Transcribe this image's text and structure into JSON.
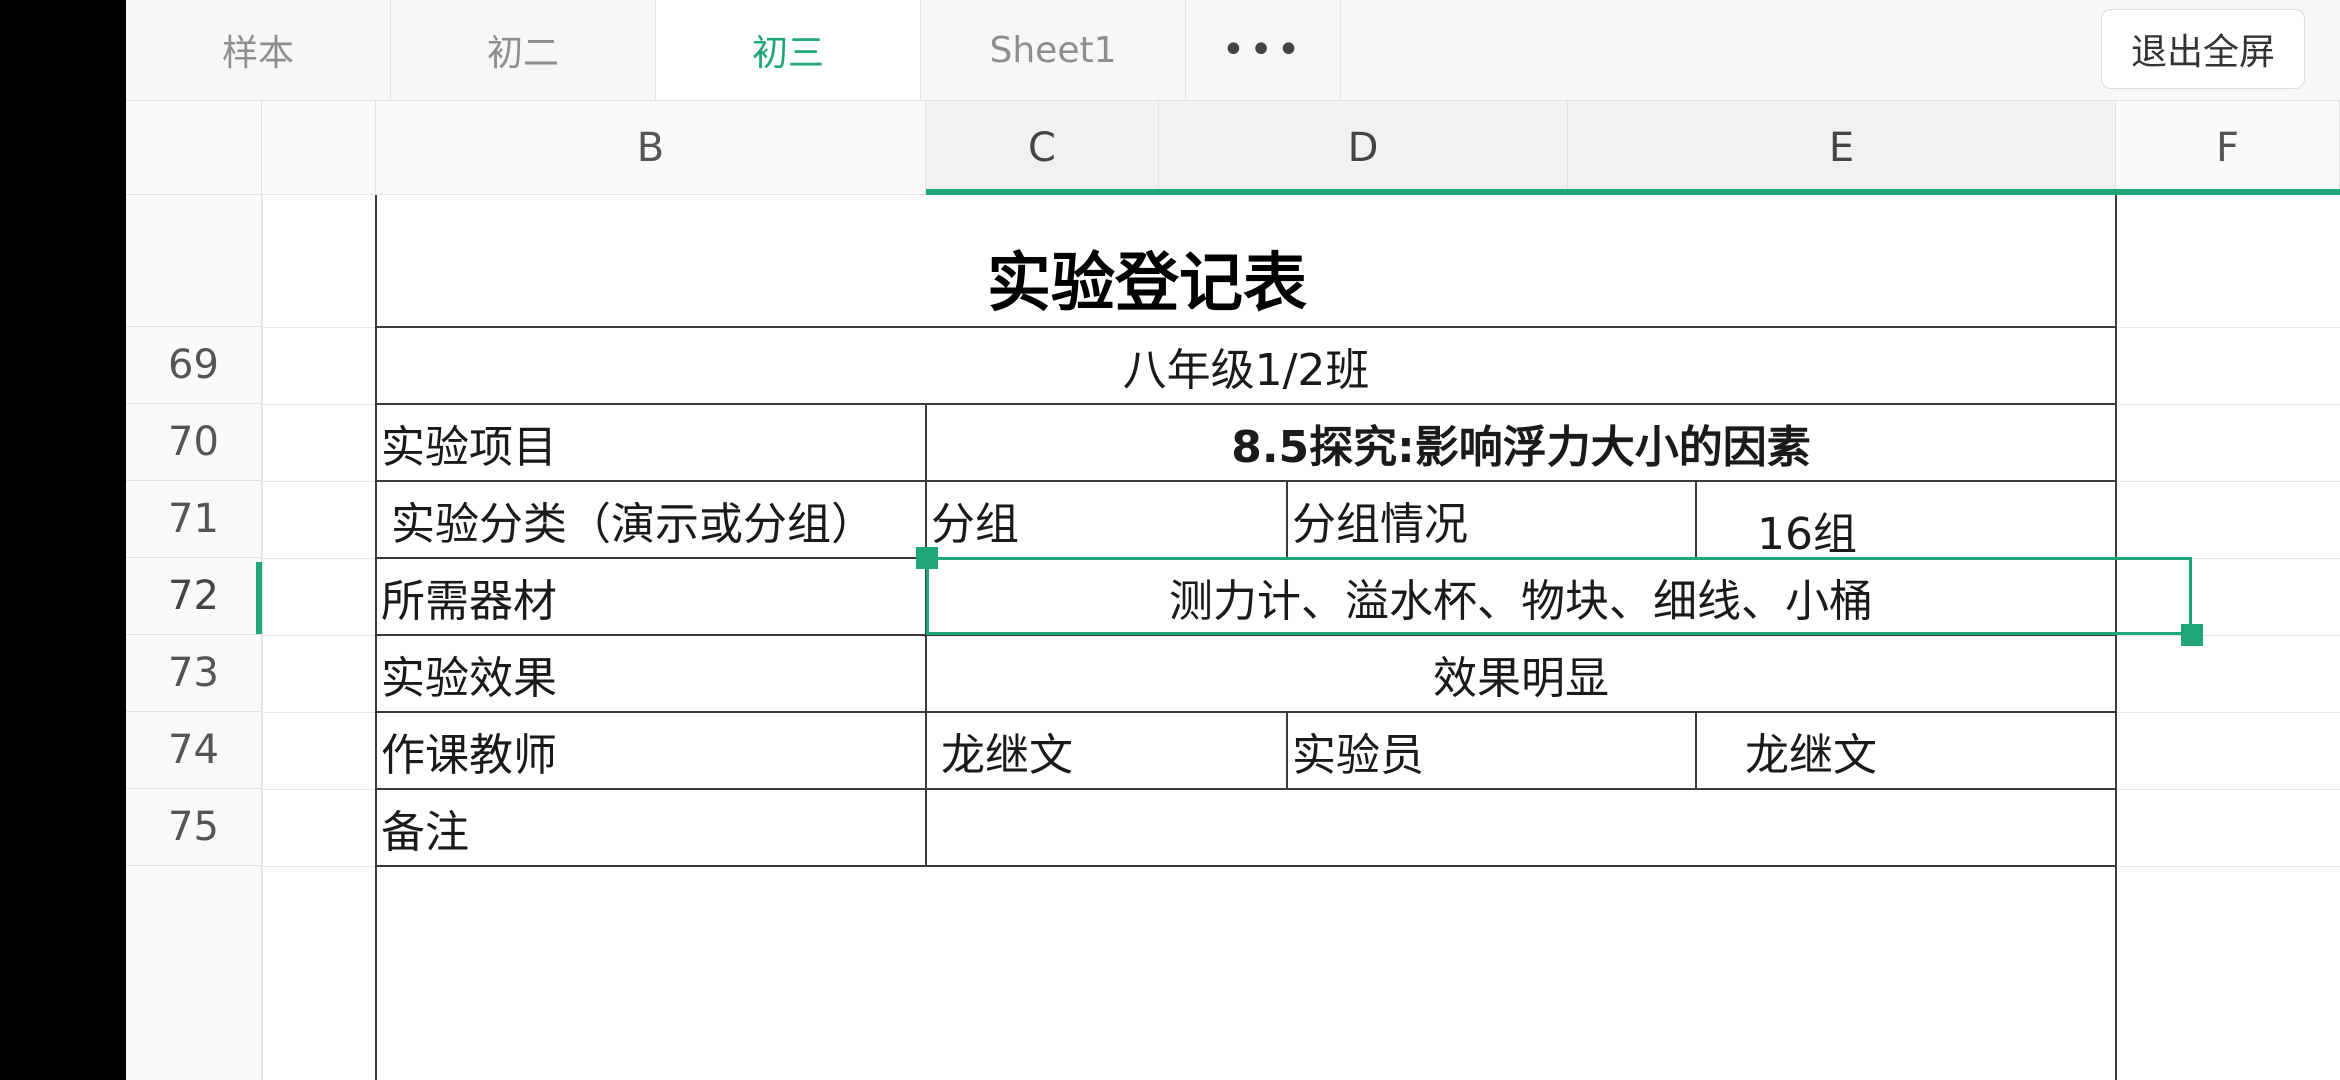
{
  "tabs": [
    {
      "label": "样本"
    },
    {
      "label": "初二"
    },
    {
      "label": "初三"
    },
    {
      "label": "Sheet1"
    }
  ],
  "more_label": "•••",
  "exit_label": "退出全屏",
  "columns": [
    "B",
    "C",
    "D",
    "E",
    "F"
  ],
  "rows": [
    "69",
    "70",
    "71",
    "72",
    "73",
    "74",
    "75"
  ],
  "form": {
    "title": "实验登记表",
    "class": "八年级1/2班",
    "project_label": "实验项目",
    "project_value": "8.5探究:影响浮力大小的因素",
    "category_label": "实验分类（演示或分组）",
    "category_value": "分组",
    "group_label": "分组情况",
    "group_value": "16组",
    "equipment_label": "所需器材",
    "equipment_value": "测力计、溢水杯、物块、细线、小桶",
    "effect_label": "实验效果",
    "effect_value": "效果明显",
    "teacher_label": "作课教师",
    "teacher_value": "龙继文",
    "assistant_label": "实验员",
    "assistant_value": "龙继文",
    "remark_label": "备注"
  },
  "colors": {
    "accent": "#1fa67a"
  }
}
